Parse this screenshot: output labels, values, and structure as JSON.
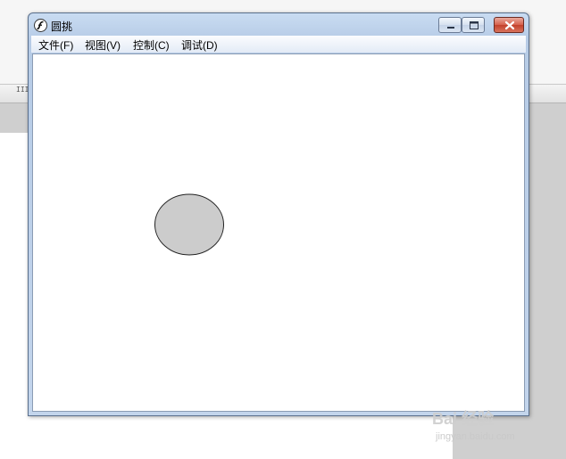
{
  "window": {
    "title": "圆挑",
    "menu": [
      "文件(F)",
      "视图(V)",
      "控制(C)",
      "调试(D)"
    ]
  },
  "stage": {
    "shape": "ellipse",
    "fill_color": "#cccccc",
    "stroke_color": "#222222"
  },
  "watermark": {
    "logo": "Bai 经验",
    "url": "jingyan.baidu.com"
  },
  "background": {
    "grip_glyph": "III"
  }
}
